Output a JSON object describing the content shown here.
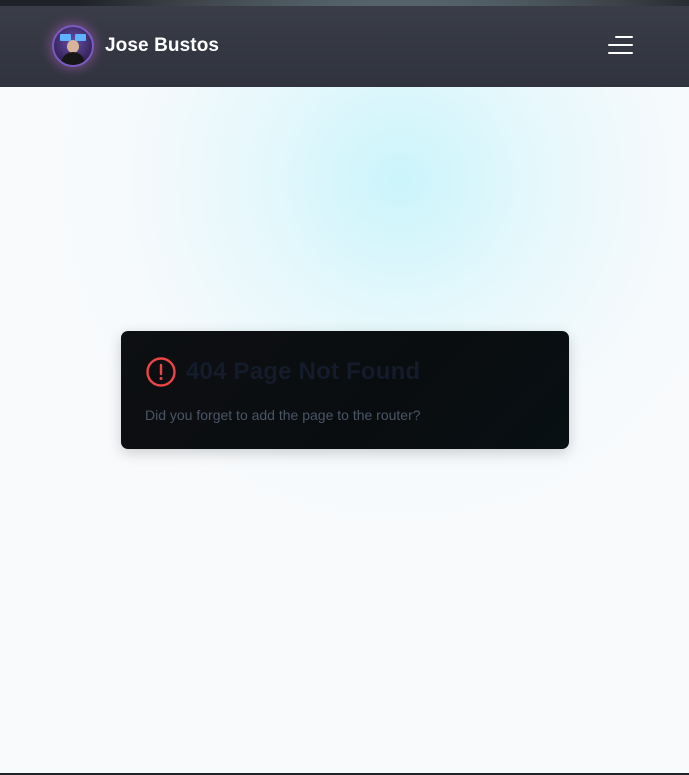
{
  "navbar": {
    "brand_name": "Jose Bustos",
    "avatar_icon": "profile-photo",
    "menu_icon": "hamburger-menu-icon"
  },
  "error_card": {
    "title": "404 Page Not Found",
    "message": "Did you forget to add the page to the router?",
    "icon": "alert-circle-icon",
    "icon_color": "#ef4444"
  },
  "colors": {
    "navbar_bg": "#353842",
    "page_bg": "#f8fafc",
    "card_bg": "#0b0e11",
    "title_color": "#141b2b",
    "glow_color": "#a5f0fa"
  }
}
